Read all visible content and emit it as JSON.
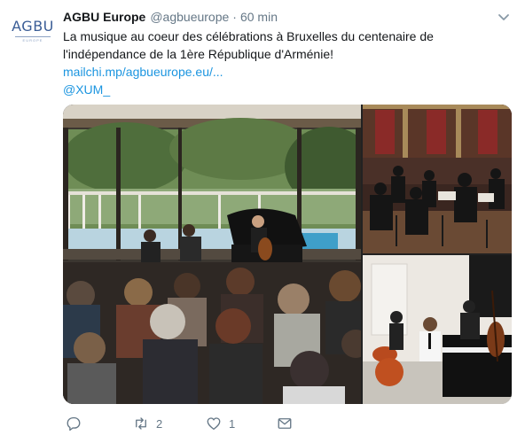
{
  "tweet": {
    "author_name": "AGBU Europe",
    "author_handle": "@agbueurope",
    "separator": "·",
    "time": "60 min",
    "text": "La musique au coeur des célébrations à Bruxelles du centenaire de l'indépendance de la 1ère République d'Arménie!",
    "link": "mailchi.mp/agbueurope.eu/...",
    "mention": "@XUM_",
    "avatar": {
      "logo_text": "AGBU",
      "logo_subtext": "EUROPE",
      "brand_color": "#3a5d96"
    },
    "actions": {
      "reply_icon": "reply-icon",
      "retweet_icon": "retweet-icon",
      "retweet_count": "2",
      "like_icon": "heart-icon",
      "like_count": "1",
      "dm_icon": "envelope-icon"
    },
    "media": [
      {
        "kind": "photo",
        "subject": "concert-in-glass-hall"
      },
      {
        "kind": "photo",
        "subject": "orchestra-rehearsal"
      },
      {
        "kind": "photo",
        "subject": "jazz-trio"
      }
    ],
    "colors": {
      "link": "#1b95e0",
      "secondary_text": "#657786",
      "primary_text": "#14171a"
    }
  }
}
